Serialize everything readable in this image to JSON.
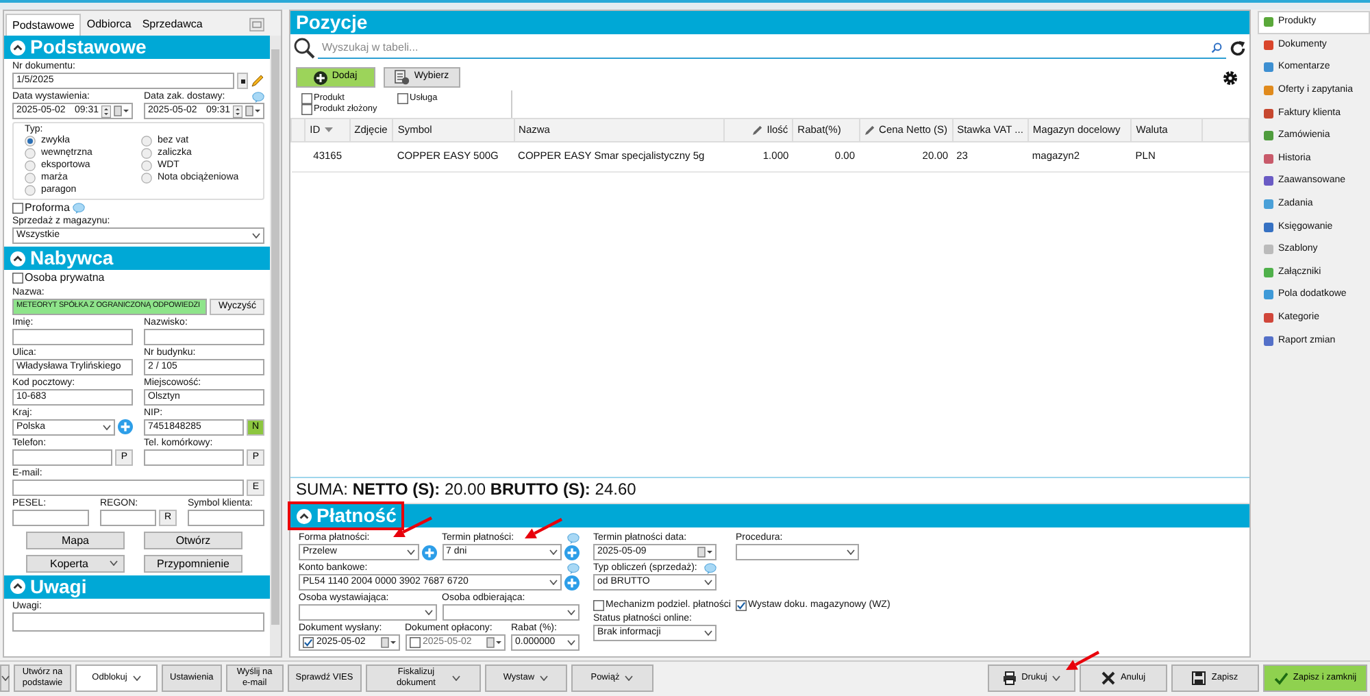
{
  "left_panel": {
    "tabs": [
      {
        "label": "Podstawowe",
        "selected": true
      },
      {
        "label": "Odbiorca",
        "selected": false
      },
      {
        "label": "Sprzedawca",
        "selected": false
      }
    ],
    "sections": [
      {
        "title": "Podstawowe",
        "rows": [
          [
            {
              "kind": "text",
              "label": "Nr dokumentu:",
              "value": "1/5/2025",
              "more_button": true,
              "edit": true
            }
          ],
          [
            {
              "kind": "datetime",
              "label": "Data wystawienia:",
              "value": "2025-05-02",
              "time": "09:31"
            },
            {
              "kind": "datetime",
              "label": "Data zak. dostawy:",
              "value": "2025-05-02",
              "time": "09:31",
              "info": true
            }
          ],
          [
            {
              "kind": "radio_group",
              "label": "Typ:",
              "options": [
                {
                  "label": "zwykła",
                  "selected": true
                },
                {
                  "label": "bez vat",
                  "selected": false
                },
                {
                  "label": "wewnętrzna",
                  "selected": false
                },
                {
                  "label": "zaliczka",
                  "selected": false
                },
                {
                  "label": "eksportowa",
                  "selected": false
                },
                {
                  "label": "WDT",
                  "selected": false
                },
                {
                  "label": "marża",
                  "selected": false
                },
                {
                  "label": "Nota obciążeniowa",
                  "selected": false
                },
                {
                  "label": "paragon",
                  "selected": false
                }
              ]
            }
          ],
          [
            {
              "kind": "checkbox",
              "label": "Proforma",
              "checked": false,
              "info": true
            }
          ],
          [
            {
              "kind": "select",
              "label": "Sprzedaż z magazynu:",
              "value": "Wszystkie"
            }
          ]
        ]
      },
      {
        "title": "Nabywca",
        "rows": [
          [
            {
              "kind": "checkbox",
              "label": "Osoba prywatna",
              "checked": false
            }
          ],
          [
            {
              "kind": "text",
              "label": "Nazwa:",
              "value": "METEORYT SPÓŁKA Z OGRANICZONĄ ODPOWIEDZI",
              "verified": true,
              "button": "Wyczyść"
            }
          ],
          [
            {
              "kind": "text",
              "label": "Imię:"
            },
            {
              "kind": "text",
              "label": "Nazwisko:"
            }
          ],
          [
            {
              "kind": "text",
              "label": "Ulica:",
              "value": "Władysława Trylińskiego"
            },
            {
              "kind": "text",
              "label": "Nr budynku:",
              "value": "2 / 105"
            }
          ],
          [
            {
              "kind": "text",
              "label": "Kod pocztowy:",
              "value": "10-683"
            },
            {
              "kind": "text",
              "label": "Miejscowość:",
              "value": "Olsztyn"
            }
          ],
          [
            {
              "kind": "select",
              "label": "Kraj:",
              "value": "Polska",
              "add": true
            },
            {
              "kind": "text",
              "label": "NIP:",
              "value": "7451848285",
              "suffix": "N",
              "verified": true
            }
          ],
          [
            {
              "kind": "text",
              "label": "Telefon:",
              "suffix": "P"
            },
            {
              "kind": "text",
              "label": "Tel. komórkowy:",
              "suffix": "P"
            }
          ],
          [
            {
              "kind": "text",
              "label": "E-mail:",
              "suffix": "E"
            }
          ],
          [
            {
              "kind": "text",
              "label": "PESEL:"
            },
            {
              "kind": "text",
              "label": "REGON:",
              "suffix": "R"
            },
            {
              "kind": "text",
              "label": "Symbol klienta:"
            }
          ],
          [
            {
              "kind": "button",
              "label": "Mapa"
            },
            {
              "kind": "button",
              "label": "Otwórz"
            }
          ],
          [
            {
              "kind": "button",
              "label": "Koperta",
              "dropdown": true
            },
            {
              "kind": "button",
              "label": "Przypomnienie"
            }
          ]
        ]
      },
      {
        "title": "Uwagi",
        "rows": [
          [
            {
              "kind": "textarea",
              "label": "Uwagi:"
            }
          ]
        ]
      }
    ]
  },
  "items_panel": {
    "title": "Pozycje",
    "search_placeholder": "Wyszukaj w tabeli...",
    "buttons": [
      {
        "label": "Dodaj",
        "kind": "add"
      },
      {
        "label": "Wybierz",
        "kind": "pick"
      }
    ],
    "filters": [
      {
        "label": "Produkt",
        "checked": false
      },
      {
        "label": "Usługa",
        "checked": false
      },
      {
        "label": "Produkt złożony",
        "checked": false
      }
    ],
    "columns": [
      {
        "label": "ID",
        "sorted": true,
        "editable": false
      },
      {
        "label": "Zdjęcie",
        "sorted": false,
        "editable": false
      },
      {
        "label": "Symbol",
        "sorted": false,
        "editable": false
      },
      {
        "label": "Nazwa",
        "sorted": false,
        "editable": false
      },
      {
        "label": "Ilość",
        "sorted": false,
        "editable": true
      },
      {
        "label": "Rabat(%)",
        "sorted": false,
        "editable": false
      },
      {
        "label": "Cena Netto (S)",
        "sorted": false,
        "editable": true
      },
      {
        "label": "Stawka VAT ...",
        "sorted": false,
        "editable": false
      },
      {
        "label": "Magazyn docelowy",
        "sorted": false,
        "editable": false
      },
      {
        "label": "Waluta",
        "sorted": false,
        "editable": false
      }
    ],
    "rows": [
      [
        "43165",
        null,
        "COPPER EASY 500G",
        "COPPER EASY Smar specjalistyczny 5g",
        "1.000",
        "0.00",
        "20.00",
        "23",
        "magazyn2",
        "PLN"
      ]
    ],
    "summary": "SUMA: **NETTO (S):** 20.00 **BRUTTO (S):** 24.60"
  },
  "payment": {
    "title": "Płatność",
    "blocks": [
      {
        "rows": [
          [
            {
              "kind": "select",
              "label": "Forma płatności:",
              "value": "Przelew",
              "add": true
            },
            {
              "kind": "select",
              "label": "Termin płatności:",
              "value": "7 dni",
              "add": true,
              "info": true
            }
          ],
          [
            {
              "kind": "select",
              "label": "Konto bankowe:",
              "value": "PL54 1140 2004 0000 3902 7687 6720",
              "add": true,
              "info": true
            }
          ],
          [
            {
              "kind": "select",
              "label": "Osoba wystawiająca:"
            },
            {
              "kind": "select",
              "label": "Osoba odbierająca:"
            }
          ],
          [
            {
              "kind": "date",
              "label": "Dokument wysłany:",
              "value": "2025-05-02",
              "checked": true,
              "disabled": false
            },
            {
              "kind": "date",
              "label": "Dokument opłacony:",
              "value": "2025-05-02",
              "checked": false,
              "disabled": true
            },
            {
              "kind": "select",
              "label": "Rabat (%):",
              "value": "0.000000"
            }
          ]
        ]
      },
      {
        "rows": [
          [
            {
              "kind": "date",
              "label": "Termin płatności data:",
              "value": "2025-05-09"
            },
            {
              "kind": "select",
              "label": "Procedura:"
            }
          ],
          [
            {
              "kind": "select",
              "label": "Typ obliczeń (sprzedaż):",
              "value": "od BRUTTO",
              "info": true
            }
          ],
          [
            {
              "kind": "checkbox",
              "label": "Mechanizm podziel. płatności",
              "checked": false
            },
            {
              "kind": "checkbox",
              "label": "Wystaw doku. magazynowy (WZ)",
              "checked": true
            }
          ],
          [
            {
              "kind": "select",
              "label": "Status płatności online:",
              "value": "Brak informacji"
            }
          ]
        ]
      }
    ]
  },
  "side_menu": [
    {
      "label": "Produkty",
      "selected": true
    },
    {
      "label": "Dokumenty",
      "selected": false
    },
    {
      "label": "Komentarze",
      "selected": false
    },
    {
      "label": "Oferty i zapytania",
      "selected": false
    },
    {
      "label": "Faktury klienta",
      "selected": false
    },
    {
      "label": "Zamówienia",
      "selected": false
    },
    {
      "label": "Historia",
      "selected": false
    },
    {
      "label": "Zaawansowane",
      "selected": false
    },
    {
      "label": "Zadania",
      "selected": false
    },
    {
      "label": "Księgowanie",
      "selected": false
    },
    {
      "label": "Szablony",
      "selected": false
    },
    {
      "label": "Załączniki",
      "selected": false
    },
    {
      "label": "Pola dodatkowe",
      "selected": false
    },
    {
      "label": "Kategorie",
      "selected": false
    },
    {
      "label": "Raport zmian",
      "selected": false
    }
  ],
  "toolbar": {
    "left": [
      {
        "dropdown": true,
        "selected": false
      },
      {
        "label": "Utwórz na podstawie",
        "dropdown": false,
        "selected": false
      },
      {
        "label": "Odblokuj",
        "dropdown": true,
        "selected": true
      },
      {
        "label": "Ustawienia",
        "dropdown": false,
        "selected": false
      },
      {
        "label": "Wyślij na e-mail",
        "dropdown": false,
        "selected": false
      },
      {
        "label": "Sprawdź VIES",
        "dropdown": false,
        "selected": false
      },
      {
        "label": "Fiskalizuj dokument",
        "dropdown": true,
        "selected": false
      },
      {
        "label": "Wystaw",
        "dropdown": true,
        "selected": false
      },
      {
        "label": "Powiąż",
        "dropdown": true,
        "selected": false
      }
    ],
    "right": [
      {
        "label": "Drukuj",
        "kind": "print",
        "dropdown": true
      },
      {
        "label": "Anuluj",
        "kind": "cancel",
        "dropdown": false
      },
      {
        "label": "Zapisz",
        "kind": "save",
        "dropdown": false
      },
      {
        "label": "Zapisz i zamknij",
        "kind": "save_close",
        "dropdown": false
      }
    ]
  }
}
